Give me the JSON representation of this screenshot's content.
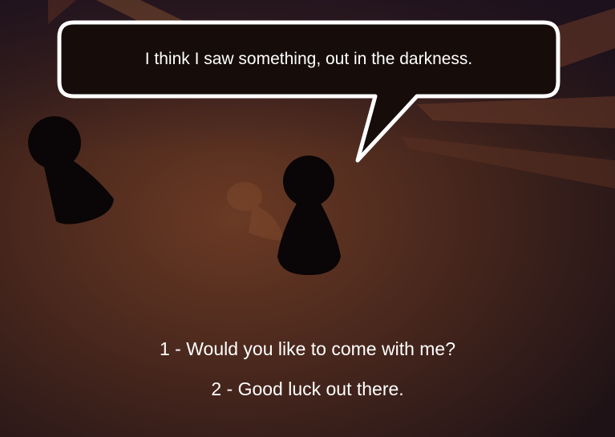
{
  "speech_bubble": {
    "text": "I think I saw something, out in the darkness."
  },
  "choices": [
    {
      "number": "1",
      "text": "Would you like to come with me?"
    },
    {
      "number": "2",
      "text": "Good luck out there."
    }
  ],
  "colors": {
    "background_center": "#6a3a24",
    "background_edge": "#1e1216",
    "bubble_fill": "#160c0a",
    "bubble_border": "#ffffff",
    "text": "#ffffff",
    "silhouette": "#0a0506"
  },
  "icons": {
    "npc_left": "pawn-silhouette-icon",
    "npc_speaker": "pawn-silhouette-icon",
    "npc_shadow": "pawn-shadow-icon"
  }
}
